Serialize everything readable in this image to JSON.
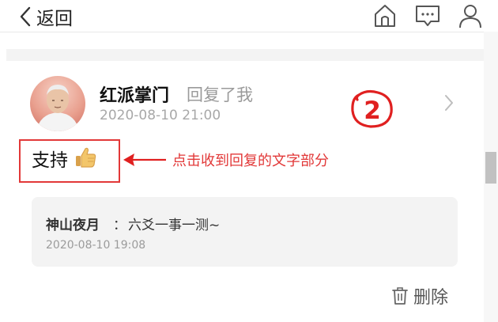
{
  "header": {
    "back_label": "返回",
    "icons": [
      "home-icon",
      "message-icon",
      "user-icon"
    ]
  },
  "comment": {
    "user_name": "红派掌门",
    "reply_tag": "回复了我",
    "time": "2020-08-10 21:00",
    "reply_text": "支持",
    "emoji": "thumbs-up-icon"
  },
  "quote": {
    "author": "神山夜月",
    "colon": "：",
    "text": "六爻一事一测~",
    "time": "2020-08-10 19:08"
  },
  "actions": {
    "delete_label": "删除"
  },
  "annotation": {
    "number": "2",
    "text": "点击收到回复的文字部分",
    "color": "#e23838"
  }
}
